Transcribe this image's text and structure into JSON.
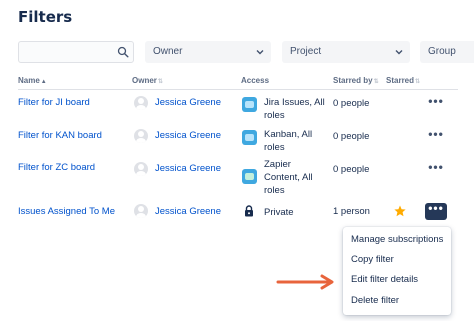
{
  "page": {
    "title": "Filters"
  },
  "filters_bar": {
    "search": {
      "value": "",
      "placeholder": ""
    },
    "owner_label": "Owner",
    "project_label": "Project",
    "group_label": "Group"
  },
  "columns": {
    "name": "Name",
    "owner": "Owner",
    "access": "Access",
    "starred_by": "Starred by",
    "starred": "Starred"
  },
  "rows": [
    {
      "name": "Filter for JI board",
      "owner": "Jessica Greene",
      "access": [
        "Jira Issues, All",
        "roles"
      ],
      "starred_by": "0 people",
      "starred": false
    },
    {
      "name": "Filter for KAN board",
      "owner": "Jessica Greene",
      "access": [
        "Kanban, All",
        "roles"
      ],
      "starred_by": "0 people",
      "starred": false
    },
    {
      "name": "Filter for ZC board",
      "owner": "Jessica Greene",
      "access": [
        "Zapier",
        "Content, All",
        "roles"
      ],
      "starred_by": "0 people",
      "starred": false
    },
    {
      "name": "Issues Assigned To Me",
      "owner": "Jessica Greene",
      "access": [
        "Private"
      ],
      "starred_by": "1 person",
      "starred": true
    }
  ],
  "actions_menu": {
    "items": [
      "Manage subscriptions",
      "Copy filter",
      "Edit filter details",
      "Delete filter"
    ]
  },
  "colors": {
    "link": "#0052cc",
    "star": "#ffab00",
    "arrow": "#e8643c",
    "active_button": "#253858"
  },
  "icons": {
    "search": "search-icon",
    "chevron": "chevron-down-icon",
    "avatar": "user-avatar-icon",
    "project": "project-avatar-icon",
    "lock": "lock-icon",
    "star": "star-icon",
    "more": "more-actions-icon",
    "arrow": "arrow-right-icon"
  }
}
